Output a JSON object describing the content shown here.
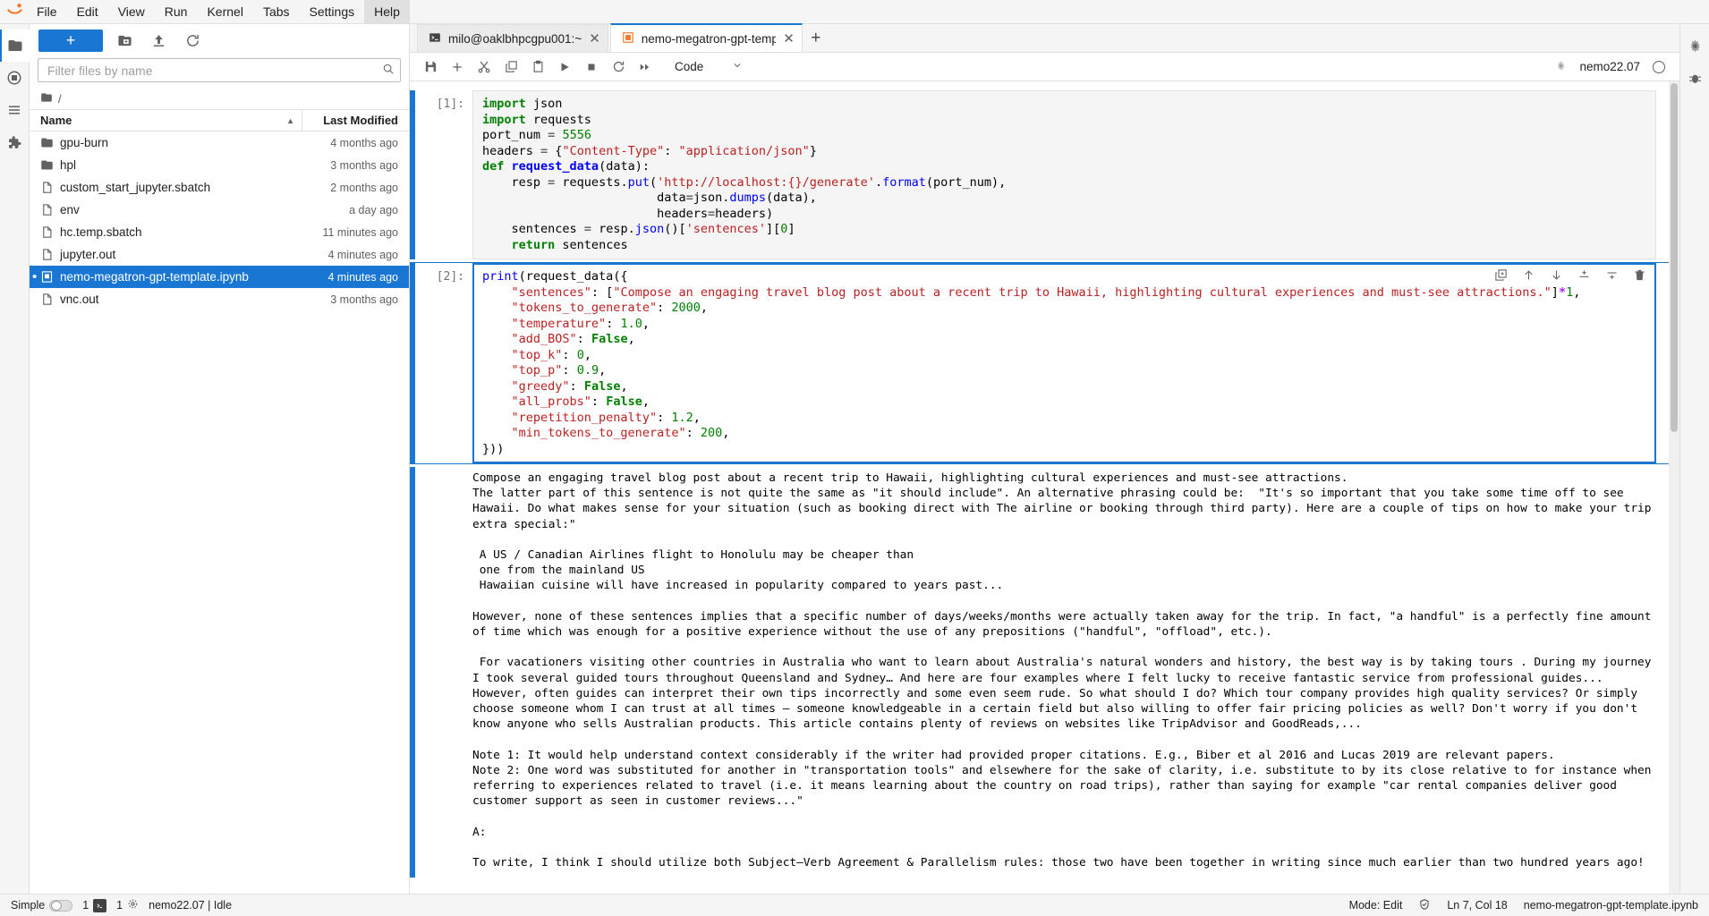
{
  "app": {
    "logo_name": "jupyter-logo",
    "menu": [
      {
        "label": "File",
        "active": false
      },
      {
        "label": "Edit",
        "active": false
      },
      {
        "label": "View",
        "active": false
      },
      {
        "label": "Run",
        "active": false
      },
      {
        "label": "Kernel",
        "active": false
      },
      {
        "label": "Tabs",
        "active": false
      },
      {
        "label": "Settings",
        "active": false
      },
      {
        "label": "Help",
        "active": true
      }
    ]
  },
  "activity_bar": {
    "items": [
      {
        "name": "file-browser-icon",
        "glyph": "folder",
        "selected": true
      },
      {
        "name": "running-terminals-icon",
        "glyph": "stop-square",
        "selected": false
      },
      {
        "name": "table-of-contents-icon",
        "glyph": "list",
        "selected": false
      },
      {
        "name": "extension-manager-icon",
        "glyph": "puzzle",
        "selected": false
      }
    ]
  },
  "activity_bar_right": {
    "items": [
      {
        "name": "property-inspector-icon",
        "glyph": "gear",
        "selected": false
      },
      {
        "name": "debugger-icon",
        "glyph": "bug",
        "selected": false
      }
    ]
  },
  "filebrowser": {
    "new_launcher_label": "+",
    "toolbar_icons": [
      {
        "name": "new-folder-icon",
        "title": "New Folder"
      },
      {
        "name": "upload-icon",
        "title": "Upload Files"
      },
      {
        "name": "refresh-icon",
        "title": "Refresh File List"
      }
    ],
    "filter": {
      "placeholder": "Filter files by name",
      "value": ""
    },
    "breadcrumb": "/",
    "columns": {
      "name": "Name",
      "last_modified": "Last Modified"
    },
    "sort_indicator": "▲",
    "items": [
      {
        "name": "gpu-burn",
        "type": "folder",
        "modified": "4 months ago",
        "selected": false,
        "dirty": false
      },
      {
        "name": "hpl",
        "type": "folder",
        "modified": "3 months ago",
        "selected": false,
        "dirty": false
      },
      {
        "name": "custom_start_jupyter.sbatch",
        "type": "file",
        "modified": "2 months ago",
        "selected": false,
        "dirty": false
      },
      {
        "name": "env",
        "type": "file",
        "modified": "a day ago",
        "selected": false,
        "dirty": false
      },
      {
        "name": "hc.temp.sbatch",
        "type": "file",
        "modified": "11 minutes ago",
        "selected": false,
        "dirty": false
      },
      {
        "name": "jupyter.out",
        "type": "file",
        "modified": "4 minutes ago",
        "selected": false,
        "dirty": false
      },
      {
        "name": "nemo-megatron-gpt-template.ipynb",
        "type": "notebook",
        "modified": "4 minutes ago",
        "selected": true,
        "dirty": true
      },
      {
        "name": "vnc.out",
        "type": "file",
        "modified": "3 months ago",
        "selected": false,
        "dirty": false
      }
    ]
  },
  "tabs": {
    "items": [
      {
        "label": "milo@oaklbhpcgpu001:~",
        "icon": "terminal-icon",
        "active": false
      },
      {
        "label": "nemo-megatron-gpt-template.ipynb",
        "icon": "notebook-icon",
        "active": true
      }
    ],
    "add_label": "+"
  },
  "notebook_toolbar": {
    "buttons": [
      {
        "name": "save-button",
        "title": "Save and create checkpoint"
      },
      {
        "name": "insert-cell-button",
        "title": "Insert a cell below"
      },
      {
        "name": "cut-cells-button",
        "title": "Cut this cell"
      },
      {
        "name": "copy-cells-button",
        "title": "Copy this cell"
      },
      {
        "name": "paste-cells-button",
        "title": "Paste this cell from the clipboard"
      },
      {
        "name": "run-cell-button",
        "title": "Run the selected cells and advance"
      },
      {
        "name": "interrupt-kernel-button",
        "title": "Interrupt the kernel"
      },
      {
        "name": "restart-kernel-button",
        "title": "Restart the kernel"
      },
      {
        "name": "restart-run-all-button",
        "title": "Restart the kernel and run all cells"
      }
    ],
    "cell_type": "Code",
    "kernel_name": "nemo22.07",
    "kernel_status": "Idle"
  },
  "cells": [
    {
      "prompt": "[1]:",
      "selected": false,
      "source_lines": [
        [
          {
            "t": "import",
            "c": "k"
          },
          {
            "t": " json",
            "c": ""
          }
        ],
        [
          {
            "t": "import",
            "c": "k"
          },
          {
            "t": " requests",
            "c": ""
          }
        ],
        [
          {
            "t": "port_num ",
            "c": ""
          },
          {
            "t": "=",
            "c": "op"
          },
          {
            "t": " ",
            "c": ""
          },
          {
            "t": "5556",
            "c": "num"
          }
        ],
        [
          {
            "t": "headers ",
            "c": ""
          },
          {
            "t": "=",
            "c": "op"
          },
          {
            "t": " {",
            "c": ""
          },
          {
            "t": "\"Content-Type\"",
            "c": "s"
          },
          {
            "t": ": ",
            "c": ""
          },
          {
            "t": "\"application/json\"",
            "c": "s"
          },
          {
            "t": "}",
            "c": ""
          }
        ],
        [
          {
            "t": "def",
            "c": "k"
          },
          {
            "t": " ",
            "c": ""
          },
          {
            "t": "request_data",
            "c": "dfn"
          },
          {
            "t": "(data):",
            "c": ""
          }
        ],
        [
          {
            "t": "    resp ",
            "c": ""
          },
          {
            "t": "=",
            "c": "op"
          },
          {
            "t": " requests.",
            "c": ""
          },
          {
            "t": "put",
            "c": "mth"
          },
          {
            "t": "(",
            "c": ""
          },
          {
            "t": "'http://localhost:{}/generate'",
            "c": "s"
          },
          {
            "t": ".",
            "c": ""
          },
          {
            "t": "format",
            "c": "mth"
          },
          {
            "t": "(port_num),",
            "c": ""
          }
        ],
        [
          {
            "t": "                        data",
            "c": ""
          },
          {
            "t": "=",
            "c": "op"
          },
          {
            "t": "json.",
            "c": ""
          },
          {
            "t": "dumps",
            "c": "mth"
          },
          {
            "t": "(data),",
            "c": ""
          }
        ],
        [
          {
            "t": "                        headers",
            "c": ""
          },
          {
            "t": "=",
            "c": "op"
          },
          {
            "t": "headers)",
            "c": ""
          }
        ],
        [
          {
            "t": "    sentences ",
            "c": ""
          },
          {
            "t": "=",
            "c": "op"
          },
          {
            "t": " resp.",
            "c": ""
          },
          {
            "t": "json",
            "c": "mth"
          },
          {
            "t": "()[",
            "c": ""
          },
          {
            "t": "'sentences'",
            "c": "s"
          },
          {
            "t": "][",
            "c": ""
          },
          {
            "t": "0",
            "c": "num"
          },
          {
            "t": "]",
            "c": ""
          }
        ],
        [
          {
            "t": "    ",
            "c": ""
          },
          {
            "t": "return",
            "c": "k"
          },
          {
            "t": " sentences",
            "c": ""
          }
        ]
      ]
    },
    {
      "prompt": "[2]:",
      "selected": true,
      "source_lines": [
        [
          {
            "t": "print",
            "c": "mth"
          },
          {
            "t": "(request_data({",
            "c": ""
          }
        ],
        [
          {
            "t": "    ",
            "c": ""
          },
          {
            "t": "\"sentences\"",
            "c": "s"
          },
          {
            "t": ": [",
            "c": ""
          },
          {
            "t": "\"Compose an engaging travel blog post about a recent trip to Hawaii, highlighting cultural experiences and must-see attractions.\"",
            "c": "s"
          },
          {
            "t": "]",
            "c": ""
          },
          {
            "t": "*",
            "c": "mag"
          },
          {
            "t": "1",
            "c": "num"
          },
          {
            "t": ",",
            "c": ""
          }
        ],
        [
          {
            "t": "    ",
            "c": ""
          },
          {
            "t": "\"tokens_to_generate\"",
            "c": "s"
          },
          {
            "t": ": ",
            "c": ""
          },
          {
            "t": "2000",
            "c": "num"
          },
          {
            "t": ",",
            "c": ""
          }
        ],
        [
          {
            "t": "    ",
            "c": ""
          },
          {
            "t": "\"temperature\"",
            "c": "s"
          },
          {
            "t": ": ",
            "c": ""
          },
          {
            "t": "1.0",
            "c": "num"
          },
          {
            "t": ",",
            "c": ""
          }
        ],
        [
          {
            "t": "    ",
            "c": ""
          },
          {
            "t": "\"add_BOS\"",
            "c": "s"
          },
          {
            "t": ": ",
            "c": ""
          },
          {
            "t": "False",
            "c": "n"
          },
          {
            "t": ",",
            "c": ""
          }
        ],
        [
          {
            "t": "    ",
            "c": ""
          },
          {
            "t": "\"top_k\"",
            "c": "s"
          },
          {
            "t": ": ",
            "c": ""
          },
          {
            "t": "0",
            "c": "num"
          },
          {
            "t": ",",
            "c": ""
          }
        ],
        [
          {
            "t": "    ",
            "c": ""
          },
          {
            "t": "\"top_p\"",
            "c": "s"
          },
          {
            "t": ": ",
            "c": ""
          },
          {
            "t": "0.9",
            "c": "num"
          },
          {
            "t": ",",
            "c": ""
          }
        ],
        [
          {
            "t": "    ",
            "c": ""
          },
          {
            "t": "\"greedy\"",
            "c": "s"
          },
          {
            "t": ": ",
            "c": ""
          },
          {
            "t": "False",
            "c": "n"
          },
          {
            "t": ",",
            "c": ""
          }
        ],
        [
          {
            "t": "    ",
            "c": ""
          },
          {
            "t": "\"all_probs\"",
            "c": "s"
          },
          {
            "t": ": ",
            "c": ""
          },
          {
            "t": "False",
            "c": "n"
          },
          {
            "t": ",",
            "c": ""
          }
        ],
        [
          {
            "t": "    ",
            "c": ""
          },
          {
            "t": "\"repetition_penalty\"",
            "c": "s"
          },
          {
            "t": ": ",
            "c": ""
          },
          {
            "t": "1.2",
            "c": "num"
          },
          {
            "t": ",",
            "c": ""
          }
        ],
        [
          {
            "t": "    ",
            "c": ""
          },
          {
            "t": "\"min_tokens_to_generate\"",
            "c": "s"
          },
          {
            "t": ": ",
            "c": ""
          },
          {
            "t": "200",
            "c": "num"
          },
          {
            "t": ",",
            "c": ""
          }
        ],
        [
          {
            "t": "}))",
            "c": ""
          }
        ]
      ],
      "actions": [
        {
          "name": "duplicate-cell-icon",
          "title": "Duplicate this cell"
        },
        {
          "name": "move-cell-up-icon",
          "title": "Move this cell up"
        },
        {
          "name": "move-cell-down-icon",
          "title": "Move this cell down"
        },
        {
          "name": "insert-cell-above-icon",
          "title": "Insert a cell above"
        },
        {
          "name": "insert-cell-below-icon",
          "title": "Insert a cell below"
        },
        {
          "name": "delete-cell-icon",
          "title": "Delete this cell"
        }
      ],
      "output_text": "Compose an engaging travel blog post about a recent trip to Hawaii, highlighting cultural experiences and must-see attractions.\nThe latter part of this sentence is not quite the same as \"it should include\". An alternative phrasing could be:  \"It's so important that you take some time off to see Hawaii. Do what makes sense for your situation (such as booking direct with The airline or booking through third party). Here are a couple of tips on how to make your trip extra special:\"\n\n A US / Canadian Airlines flight to Honolulu may be cheaper than\n one from the mainland US\n Hawaiian cuisine will have increased in popularity compared to years past...\n\nHowever, none of these sentences implies that a specific number of days/weeks/months were actually taken away for the trip. In fact, \"a handful\" is a perfectly fine amount of time which was enough for a positive experience without the use of any prepositions (\"handful\", \"offload\", etc.).\n\n For vacationers visiting other countries in Australia who want to learn about Australia's natural wonders and history, the best way is by taking tours . During my journey I took several guided tours throughout Queensland and Sydney… And here are four examples where I felt lucky to receive fantastic service from professional guides... However, often guides can interpret their own tips incorrectly and some even seem rude. So what should I do? Which tour company provides high quality services? Or simply choose someone whom I can trust at all times – someone knowledgeable in a certain field but also willing to offer fair pricing policies as well? Don't worry if you don't know anyone who sells Australian products. This article contains plenty of reviews on websites like TripAdvisor and GoodReads,...\n\nNote 1: It would help understand context considerably if the writer had provided proper citations. E.g., Biber et al 2016 and Lucas 2019 are relevant papers.\nNote 2: One word was substituted for another in \"transportation tools\" and elsewhere for the sake of clarity, i.e. substitute to by its close relative to for instance when referring to experiences related to travel (i.e. it means learning about the country on road trips), rather than saying for example \"car rental companies deliver good customer support as seen in customer reviews...\"\n\nA:\n\nTo write, I think I should utilize both Subject–Verb Agreement & Parallelism rules: those two have been together in writing since much earlier than two hundred years ago!"
    }
  ],
  "statusbar": {
    "simple_label": "Simple",
    "simple_on": false,
    "terminal_count": "1",
    "kernel_count": "1",
    "kernel_status": "nemo22.07 | Idle",
    "mode": "Mode: Edit",
    "cursor": "Ln 7, Col 18",
    "filename": "nemo-megatron-gpt-template.ipynb"
  },
  "colors": {
    "accent": "#1976d2",
    "toolbar_bg": "#f5f5f5",
    "border": "#e0e0e0",
    "string": "#ba2121",
    "keyword": "#008000",
    "builtin": "#0000ff"
  }
}
